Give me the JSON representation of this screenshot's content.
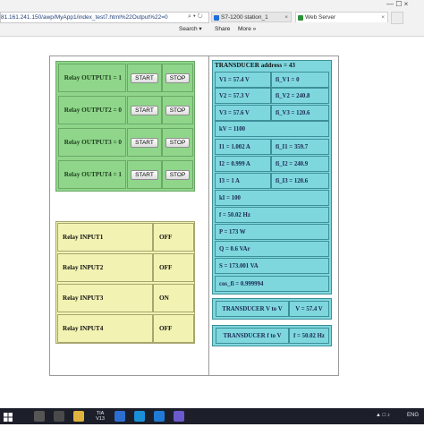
{
  "browser": {
    "address": "81.161.241.150/awp/MyApp1/index_test7.html%22Output%22=0",
    "addr_controls": "⌕ ▾ ↻",
    "tabs": [
      {
        "label": "S7-1200 station_1",
        "close": "×"
      },
      {
        "label": "Web Server",
        "close": "×"
      }
    ],
    "window_controls": "—  ☐  ×",
    "commands": {
      "search": "Search ▾",
      "share": "Share",
      "more": "More »"
    },
    "colors": {
      "tab1_icon": "#1e6fd9",
      "tab2_icon": "#2d8f3a"
    }
  },
  "outputs": [
    {
      "label": "Relay OUTPUT1 = 1",
      "start": "START",
      "stop": "STOP"
    },
    {
      "label": "Relay OUTPUT2 = 0",
      "start": "START",
      "stop": "STOP"
    },
    {
      "label": "Relay OUTPUT3 = 0",
      "start": "START",
      "stop": "STOP"
    },
    {
      "label": "Relay OUTPUT4 = 1",
      "start": "START",
      "stop": "STOP"
    }
  ],
  "inputs": [
    {
      "label": "Relay INPUT1",
      "value": "OFF"
    },
    {
      "label": "Relay INPUT2",
      "value": "OFF"
    },
    {
      "label": "Relay INPUT3",
      "value": "ON"
    },
    {
      "label": "Relay INPUT4",
      "value": "OFF"
    }
  ],
  "transducer": {
    "title": "TRANSDUCER address = 43",
    "rows": [
      [
        "V1 = 57.4 V",
        "fi_V1 = 0"
      ],
      [
        "V2 = 57.3 V",
        "fi_V2 = 240.8"
      ],
      [
        "V3 = 57.6 V",
        "fi_V3 = 120.6"
      ],
      [
        "kV = 1100"
      ],
      [
        "I1 = 1.002 A",
        "fi_I1 = 359.7"
      ],
      [
        "I2 = 0.999 A",
        "fi_I2 = 240.9"
      ],
      [
        "I3 = 1 A",
        "fi_I3 = 120.6"
      ],
      [
        "kI = 100"
      ],
      [
        "f = 50.02 Hz"
      ],
      [
        "P = 173 W"
      ],
      [
        "Q = 0.6 VAr"
      ],
      [
        "S = 173.001 VA"
      ],
      [
        "cos_fi = 0.999994"
      ]
    ],
    "v_to_v": {
      "label": "TRANSDUCER V to V",
      "value": "V = 57.4 V"
    },
    "f_to_v": {
      "label": "TRANSDUCER f to V",
      "value": "f = 50.02 Hz"
    }
  },
  "taskbar": {
    "tia_label": "TIA V13",
    "tray_text": "ENG",
    "tray_icons": "▲ □ ♪"
  },
  "colors": {
    "outputs_bg": "#8fd68a",
    "inputs_bg": "#f2f2b2",
    "transducer_bg": "#7fd7de",
    "taskbar_bg": "#1c1f2a"
  }
}
